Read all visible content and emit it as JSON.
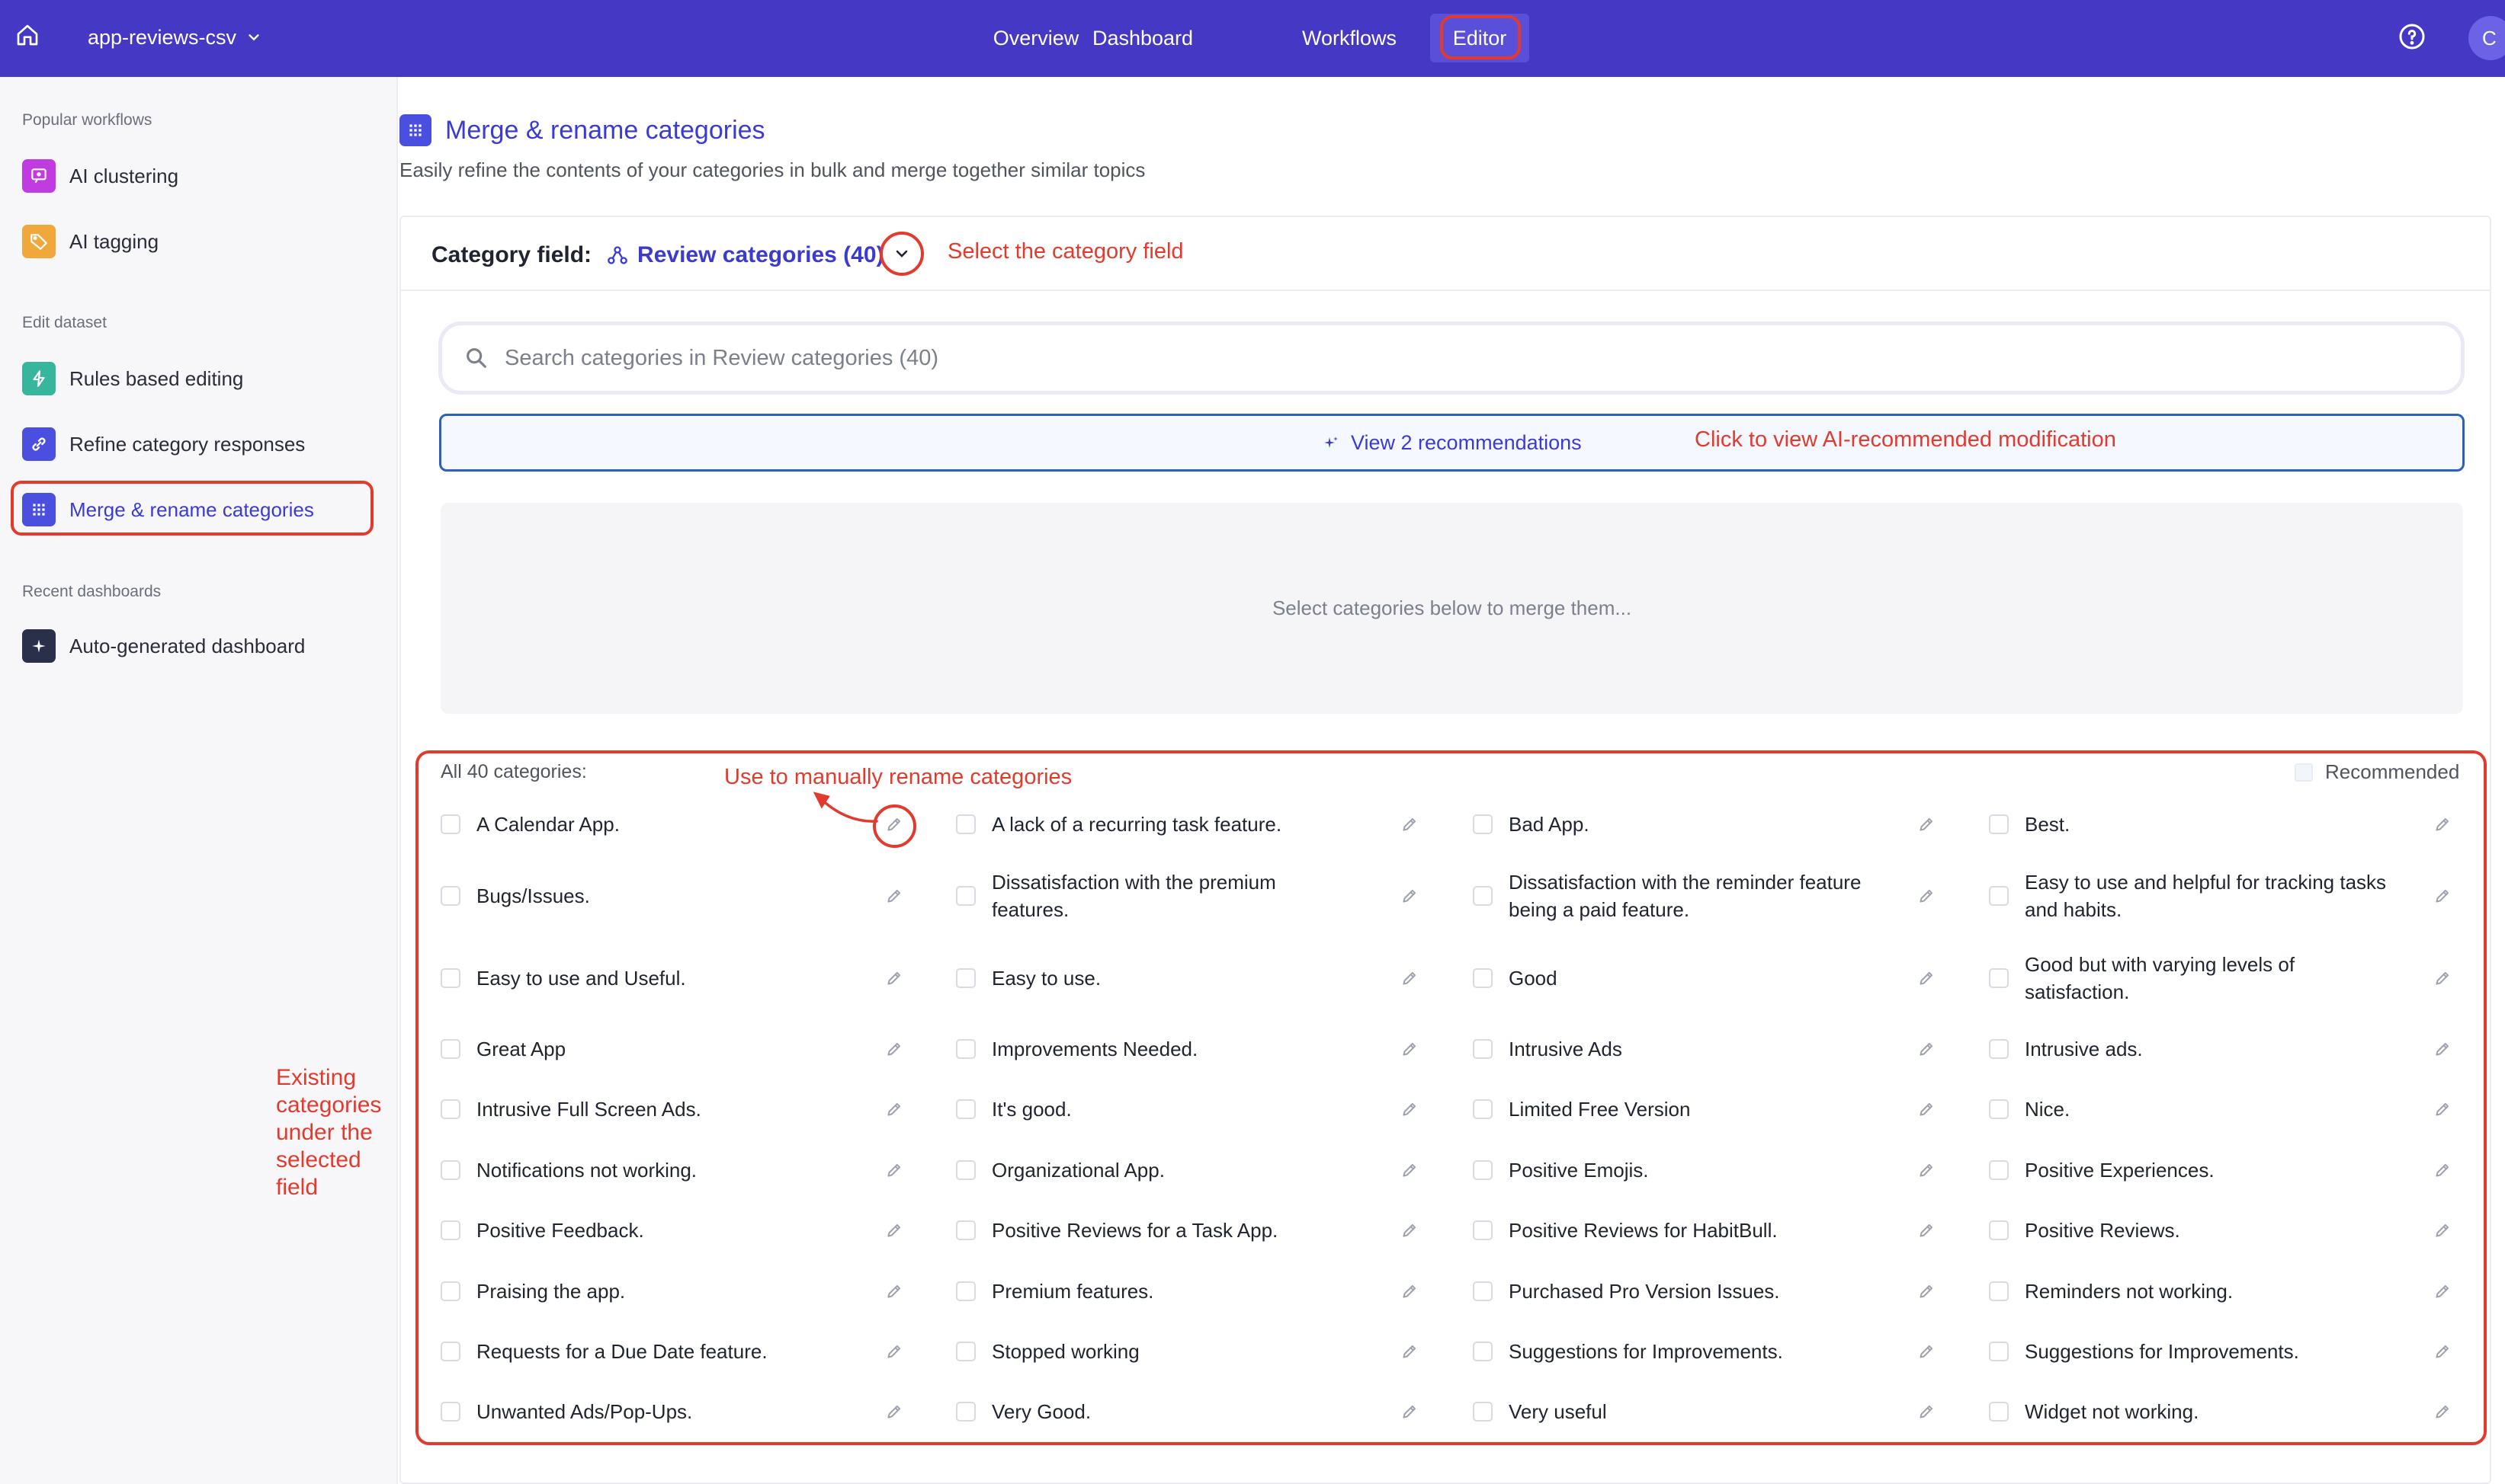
{
  "topbar": {
    "dataset_name": "app-reviews-csv",
    "nav": [
      "Overview",
      "Dashboard",
      "Workflows",
      "Editor"
    ],
    "active_tab": "Editor",
    "avatar_initial": "C"
  },
  "sidebar": {
    "popular_label": "Popular workflows",
    "popular": [
      {
        "label": "AI clustering",
        "icon": "chat-cluster-icon",
        "color": "#c03be0"
      },
      {
        "label": "AI tagging",
        "icon": "tag-icon",
        "color": "#f0a83a"
      }
    ],
    "edit_label": "Edit dataset",
    "edit": [
      {
        "label": "Rules based editing",
        "icon": "bolt-icon",
        "color": "#37b59d"
      },
      {
        "label": "Refine category responses",
        "icon": "link-icon",
        "color": "#4b4fe0"
      },
      {
        "label": "Merge & rename categories",
        "icon": "grid-icon",
        "color": "#4b4fe0"
      }
    ],
    "recent_label": "Recent dashboards",
    "recent": [
      {
        "label": "Auto-generated dashboard",
        "icon": "sparkle-icon",
        "color": "#2a2f4a"
      }
    ],
    "annotation": "Existing categories under the selected field"
  },
  "main": {
    "title": "Merge & rename categories",
    "subtitle": "Easily refine the contents of your categories in bulk and merge together similar topics",
    "field_label": "Category field:",
    "field_value": "Review categories (40)",
    "field_annotation": "Select the category field",
    "search_placeholder": "Search categories in Review categories (40)",
    "reco_label": "View 2 recommendations",
    "reco_annotation": "Click to view AI-recommended modification",
    "dropzone_text": "Select categories below to merge them...",
    "categories_header": "All 40 categories:",
    "rename_annotation": "Use to manually rename categories",
    "recommended_label": "Recommended",
    "accent_color": "#4438c4",
    "annotation_color": "#e23b2e"
  },
  "categories": [
    [
      "A Calendar App.",
      "A lack of a recurring task feature.",
      "Bad App.",
      "Best."
    ],
    [
      "Bugs/Issues.",
      "Dissatisfaction with the premium features.",
      "Dissatisfaction with the reminder feature being a paid feature.",
      "Easy to use and helpful for tracking tasks and habits."
    ],
    [
      "Easy to use and Useful.",
      "Easy to use.",
      "Good",
      "Good but with varying levels of satisfaction."
    ],
    [
      "Great App",
      "Improvements Needed.",
      "Intrusive Ads",
      "Intrusive ads."
    ],
    [
      "Intrusive Full Screen Ads.",
      "It's good.",
      "Limited Free Version",
      "Nice."
    ],
    [
      "Notifications not working.",
      "Organizational App.",
      "Positive Emojis.",
      "Positive Experiences."
    ],
    [
      "Positive Feedback.",
      "Positive Reviews for a Task App.",
      "Positive Reviews for HabitBull.",
      "Positive Reviews."
    ],
    [
      "Praising the app.",
      "Premium features.",
      "Purchased Pro Version Issues.",
      "Reminders not working."
    ],
    [
      "Requests for a Due Date feature.",
      "Stopped working",
      "Suggestions for Improvements.",
      "Suggestions for Improvements."
    ],
    [
      "Unwanted Ads/Pop-Ups.",
      "Very Good.",
      "Very useful",
      "Widget not working."
    ]
  ]
}
